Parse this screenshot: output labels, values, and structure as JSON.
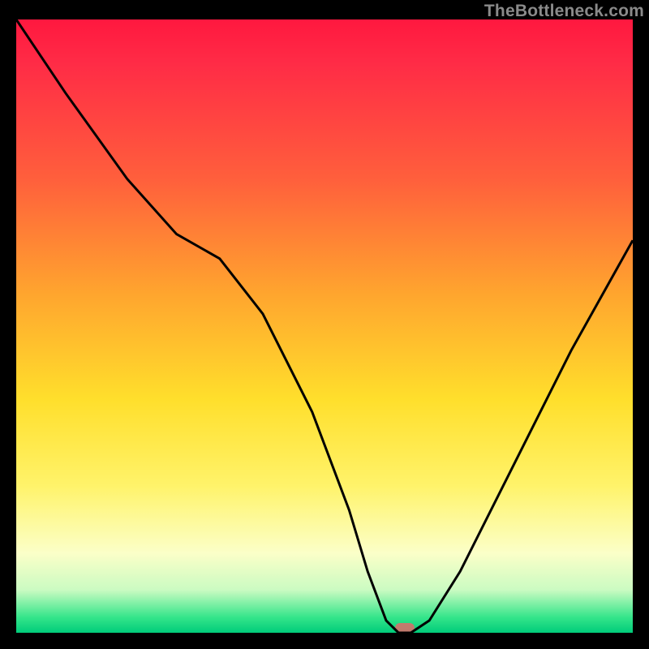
{
  "watermark": "TheBottleneck.com",
  "colors": {
    "marker": "#e06a6a",
    "curve": "#000000"
  },
  "chart_data": {
    "type": "line",
    "title": "",
    "xlabel": "",
    "ylabel": "",
    "xlim": [
      0,
      100
    ],
    "ylim": [
      0,
      100
    ],
    "grid": false,
    "legend": false,
    "series": [
      {
        "name": "bottleneck-curve",
        "x": [
          0,
          8,
          18,
          26,
          33,
          40,
          48,
          54,
          57,
          60,
          62,
          64,
          67,
          72,
          80,
          90,
          100
        ],
        "values": [
          100,
          88,
          74,
          65,
          61,
          52,
          36,
          20,
          10,
          2,
          0,
          0,
          2,
          10,
          26,
          46,
          64
        ]
      }
    ],
    "marker": {
      "x": 63,
      "width_pct": 3.2
    },
    "gradient_stops": [
      {
        "pct": 0,
        "color": "#ff183f"
      },
      {
        "pct": 7,
        "color": "#ff2b46"
      },
      {
        "pct": 26,
        "color": "#ff5f3c"
      },
      {
        "pct": 45,
        "color": "#ffa62e"
      },
      {
        "pct": 62,
        "color": "#ffdf2c"
      },
      {
        "pct": 76,
        "color": "#fff36a"
      },
      {
        "pct": 87,
        "color": "#fbffc8"
      },
      {
        "pct": 93,
        "color": "#cbfbc2"
      },
      {
        "pct": 97.5,
        "color": "#34e58a"
      },
      {
        "pct": 100,
        "color": "#00cc7a"
      }
    ]
  }
}
